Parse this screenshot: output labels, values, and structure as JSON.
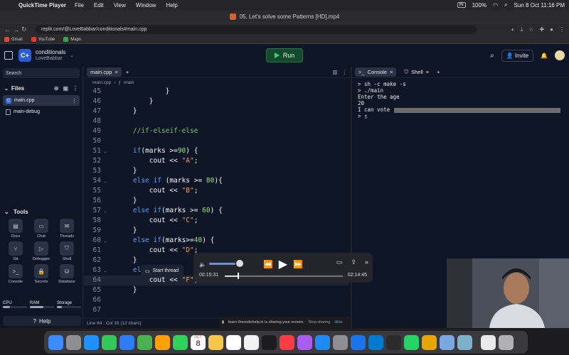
{
  "menubar": {
    "app_name": "QuickTime Player",
    "menus": [
      "File",
      "Edit",
      "View",
      "Window",
      "Help"
    ],
    "input_source": "IN",
    "battery": "100%",
    "datetime": "Sun 8 Oct  11:16 PM"
  },
  "browser": {
    "tab_title": "05. Let's solve some Patterns [HD].mp4",
    "url": "replit.com/@LoveBabbar/conditionals#main.cpp",
    "bookmarks": [
      {
        "label": "Gmail",
        "color": "#d94a3a"
      },
      {
        "label": "YouTube",
        "color": "#e53935"
      },
      {
        "label": "Maps",
        "color": "#34a853"
      }
    ]
  },
  "replit": {
    "logo_text": "C+",
    "project_name": "conditionals",
    "owner": "LoveBabbar",
    "run_label": "Run",
    "invite_label": "Invite",
    "accent_green": "#39d27a"
  },
  "sidebar": {
    "search_label": "Search",
    "files_label": "Files",
    "files": [
      {
        "name": "main.cpp",
        "active": true
      },
      {
        "name": "main-debug",
        "active": false
      }
    ],
    "tools_label": "Tools",
    "tools": [
      {
        "label": "Docs",
        "icon": "docs-icon",
        "glyph": "▤"
      },
      {
        "label": "Chat",
        "icon": "chat-icon",
        "glyph": "▭"
      },
      {
        "label": "Threads",
        "icon": "threads-icon",
        "glyph": "✉"
      },
      {
        "label": "Git",
        "icon": "git-icon",
        "glyph": "⑂"
      },
      {
        "label": "Debugger",
        "icon": "debugger-icon",
        "glyph": "▷"
      },
      {
        "label": "Shell",
        "icon": "shell-icon",
        "glyph": "⛉"
      },
      {
        "label": "Console",
        "icon": "console-icon",
        "glyph": ">_"
      },
      {
        "label": "Secrets",
        "icon": "secrets-icon",
        "glyph": "🔒"
      },
      {
        "label": "Database",
        "icon": "database-icon",
        "glyph": "⛁"
      }
    ],
    "meters": [
      {
        "label": "CPU",
        "level": 0.3
      },
      {
        "label": "RAM",
        "level": 0.55
      },
      {
        "label": "Storage",
        "level": 0.2
      }
    ],
    "help_label": "Help"
  },
  "editor": {
    "tab_label": "main.cpp",
    "breadcrumb_file": "main.cpp",
    "breadcrumb_fn": "main",
    "status": "Line 64 : Col 15 (12 chars)",
    "current_line": 64,
    "lines": [
      {
        "n": 45,
        "text": "            }",
        "fold": false
      },
      {
        "n": 46,
        "text": "        }",
        "fold": false
      },
      {
        "n": 47,
        "text": "    }",
        "fold": false
      },
      {
        "n": 48,
        "text": "",
        "fold": false
      },
      {
        "n": 49,
        "text": "    //if-elseif-else",
        "fold": false
      },
      {
        "n": 50,
        "text": "",
        "fold": false
      },
      {
        "n": 51,
        "text": "    if(marks >=90) {",
        "fold": true
      },
      {
        "n": 52,
        "text": "        cout << \"A\";",
        "fold": false
      },
      {
        "n": 53,
        "text": "    }",
        "fold": false
      },
      {
        "n": 54,
        "text": "    else if (marks >= 80){",
        "fold": true
      },
      {
        "n": 55,
        "text": "        cout << \"B\";",
        "fold": false
      },
      {
        "n": 56,
        "text": "    }",
        "fold": false
      },
      {
        "n": 57,
        "text": "    else if(marks >= 60) {",
        "fold": true
      },
      {
        "n": 58,
        "text": "        cout << \"C\";",
        "fold": false
      },
      {
        "n": 59,
        "text": "    }",
        "fold": false
      },
      {
        "n": 60,
        "text": "    else if(marks>=40) {",
        "fold": true
      },
      {
        "n": 61,
        "text": "        cout << \"D\";",
        "fold": false
      },
      {
        "n": 62,
        "text": "    }",
        "fold": false
      },
      {
        "n": 63,
        "text": "    else",
        "fold": true
      },
      {
        "n": 64,
        "text": "        cout << \"F\";",
        "fold": false
      },
      {
        "n": 65,
        "text": "    }",
        "fold": false
      },
      {
        "n": 66,
        "text": "",
        "fold": false
      },
      {
        "n": 67,
        "text": "",
        "fold": false
      }
    ],
    "thread_popup": "Start thread"
  },
  "console": {
    "tabs": [
      "Console",
      "Shell"
    ],
    "output": [
      "sh -c make -s",
      "./main",
      "Enter the age",
      "20",
      "I can vote"
    ],
    "prompt_prefixes": [
      "> ",
      "> ",
      "",
      "",
      ""
    ]
  },
  "share_notice": {
    "text": "learn.thecodehelp.in is sharing your screen.",
    "stop_label": "Stop sharing",
    "hide_label": "Hide"
  },
  "player": {
    "elapsed": "00:15:31",
    "remaining": "02:14:45",
    "progress": 0.11,
    "volume": 0.85
  },
  "dock": {
    "items": [
      "Finder",
      "Launchpad",
      "Safari",
      "Messages",
      "Mail",
      "Maps",
      "Photos",
      "FaceTime",
      "Calendar",
      "Notes",
      "Reminders",
      "Freeform",
      "TV",
      "Music",
      "Podcasts",
      "App Store",
      "System Settings",
      "Xcode",
      "VS Code",
      "Terminal",
      "WhatsApp",
      "Chrome",
      "Preview",
      "QuickTime",
      "Notes Widget",
      "Trash"
    ],
    "calendar_month": "OCT",
    "calendar_day": "8"
  }
}
